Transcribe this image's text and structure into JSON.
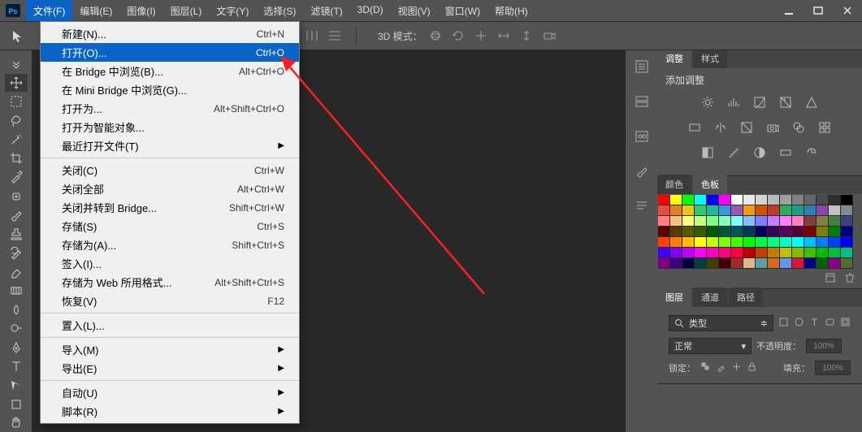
{
  "app": {
    "name": "Ps"
  },
  "menubar": {
    "items": [
      {
        "label": "文件(F)"
      },
      {
        "label": "编辑(E)"
      },
      {
        "label": "图像(I)"
      },
      {
        "label": "图层(L)"
      },
      {
        "label": "文字(Y)"
      },
      {
        "label": "选择(S)"
      },
      {
        "label": "滤镜(T)"
      },
      {
        "label": "3D(D)"
      },
      {
        "label": "视图(V)"
      },
      {
        "label": "窗口(W)"
      },
      {
        "label": "帮助(H)"
      }
    ],
    "active_index": 0
  },
  "file_menu": {
    "groups": [
      [
        {
          "label": "新建(N)...",
          "shortcut": "Ctrl+N"
        },
        {
          "label": "打开(O)...",
          "shortcut": "Ctrl+O",
          "highlight": true
        },
        {
          "label": "在 Bridge 中浏览(B)...",
          "shortcut": "Alt+Ctrl+O"
        },
        {
          "label": "在 Mini Bridge 中浏览(G)..."
        },
        {
          "label": "打开为...",
          "shortcut": "Alt+Shift+Ctrl+O"
        },
        {
          "label": "打开为智能对象..."
        },
        {
          "label": "最近打开文件(T)",
          "submenu": true
        }
      ],
      [
        {
          "label": "关闭(C)",
          "shortcut": "Ctrl+W"
        },
        {
          "label": "关闭全部",
          "shortcut": "Alt+Ctrl+W"
        },
        {
          "label": "关闭并转到 Bridge...",
          "shortcut": "Shift+Ctrl+W"
        },
        {
          "label": "存储(S)",
          "shortcut": "Ctrl+S"
        },
        {
          "label": "存储为(A)...",
          "shortcut": "Shift+Ctrl+S"
        },
        {
          "label": "签入(I)..."
        },
        {
          "label": "存储为 Web 所用格式...",
          "shortcut": "Alt+Shift+Ctrl+S"
        },
        {
          "label": "恢复(V)",
          "shortcut": "F12"
        }
      ],
      [
        {
          "label": "置入(L)..."
        }
      ],
      [
        {
          "label": "导入(M)",
          "submenu": true
        },
        {
          "label": "导出(E)",
          "submenu": true
        }
      ],
      [
        {
          "label": "自动(U)",
          "submenu": true
        },
        {
          "label": "脚本(R)",
          "submenu": true
        }
      ]
    ]
  },
  "toolbar": {
    "mode3d_label": "3D 模式："
  },
  "panels": {
    "adjustments": {
      "tab1": "调整",
      "tab2": "样式",
      "title": "添加调整"
    },
    "color": {
      "tab1": "颜色",
      "tab2": "色板",
      "swatches": [
        "#ff0000",
        "#ffff00",
        "#00ff00",
        "#00ffff",
        "#0000ff",
        "#ff00ff",
        "#ffffff",
        "#e9e9e9",
        "#d4d4d4",
        "#bababa",
        "#9e9e9e",
        "#828282",
        "#666666",
        "#4a4a4a",
        "#2e2e2e",
        "#000000",
        "#e74c3c",
        "#e67e22",
        "#f1c40f",
        "#2ecc71",
        "#1abc9c",
        "#3498db",
        "#9b59b6",
        "#f39c12",
        "#d35400",
        "#c0392b",
        "#27ae60",
        "#16a085",
        "#2980b9",
        "#8e44ad",
        "#bdc3c7",
        "#7f8c8d",
        "#ff8080",
        "#ffc080",
        "#ffff80",
        "#c0ff80",
        "#80ff80",
        "#80ffc0",
        "#80ffff",
        "#80c0ff",
        "#8080ff",
        "#c080ff",
        "#ff80ff",
        "#ff80c0",
        "#804040",
        "#808040",
        "#408040",
        "#404080",
        "#590000",
        "#593b00",
        "#595900",
        "#3b5900",
        "#005900",
        "#00593b",
        "#005959",
        "#003b59",
        "#000059",
        "#3b0059",
        "#590059",
        "#59003b",
        "#800000",
        "#808000",
        "#008000",
        "#000080",
        "#ff4000",
        "#ff8000",
        "#ffbf00",
        "#ffff00",
        "#bfff00",
        "#80ff00",
        "#40ff00",
        "#00ff00",
        "#00ff40",
        "#00ff80",
        "#00ffbf",
        "#00ffff",
        "#00bfff",
        "#0080ff",
        "#0040ff",
        "#0000ff",
        "#4000ff",
        "#8000ff",
        "#bf00ff",
        "#ff00ff",
        "#ff00bf",
        "#ff0080",
        "#ff0040",
        "#bf0000",
        "#bf4000",
        "#bf8000",
        "#bfbf00",
        "#80bf00",
        "#40bf00",
        "#00bf00",
        "#00bf40",
        "#00bf80",
        "#800080",
        "#400080",
        "#000040",
        "#004040",
        "#404000",
        "#400000",
        "#a52a2a",
        "#deb887",
        "#5f9ea0",
        "#d2691e",
        "#6495ed",
        "#dc143c",
        "#00008b",
        "#006400",
        "#8b008b",
        "#556b2f"
      ]
    },
    "layers": {
      "tab1": "图层",
      "tab2": "通道",
      "tab3": "路径",
      "type_select": "类型",
      "blend_mode": "正常",
      "opacity_label": "不透明度：",
      "opacity_value": "100%",
      "lock_label": "锁定：",
      "fill_label": "填充：",
      "fill_value": "100%"
    }
  }
}
